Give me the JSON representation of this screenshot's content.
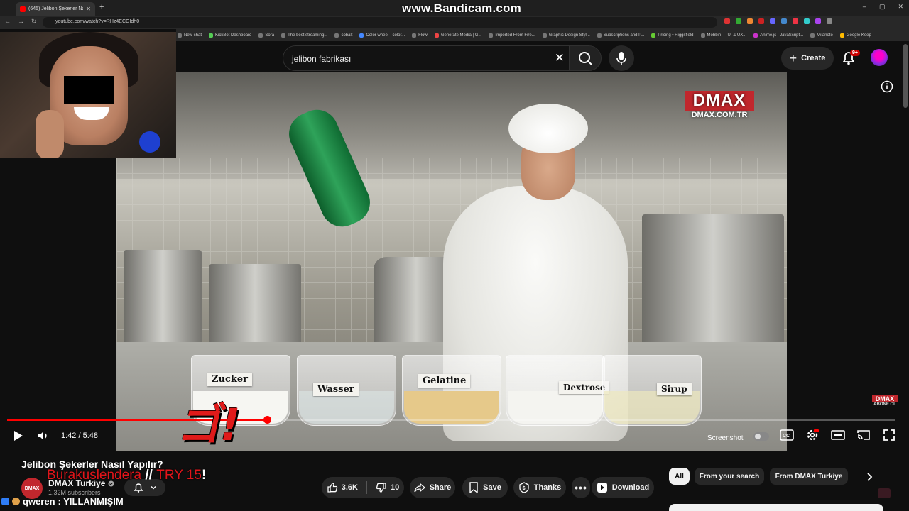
{
  "browser": {
    "tab_title": "(645) Jelibon Şekerler Nasıl Yapı",
    "url": "youtube.com/watch?v=RHz4ECGIdh0",
    "watermark": "www.Bandicam.com",
    "bookmarks": [
      "New chat",
      "KickBot Dashboard",
      "Sora",
      "The best streaming...",
      "cobalt",
      "Color wheel - color...",
      "Flow",
      "Generate Media | G...",
      "Imported From Fire...",
      "Graphic Design Styl...",
      "Subscriptions and P...",
      "Pricing • Higgsfield",
      "Mobbin — UI & UX...",
      "Anime.js | JavaScript...",
      "Milanote",
      "Google Keep"
    ]
  },
  "header": {
    "search_value": "jelibon fabrikası",
    "create_label": "Create",
    "notifications_badge": "9+"
  },
  "video": {
    "bowl_labels": [
      "Zucker",
      "Wasser",
      "Gelatine",
      "Dextrose",
      "Sirup"
    ],
    "watermark_main": "DMAX",
    "watermark_url": "DMAX.COM.TR",
    "corner_logo": "DMAX",
    "corner_logo_sub": "ABONE OL",
    "current_time": "1:42",
    "duration": "5:48",
    "progress_fraction": 0.293,
    "screenshot_label": "Screenshot"
  },
  "overlay": {
    "pow_text": "ゴ!",
    "name": "Burakuslendera",
    "sep": " // ",
    "tag": "TRY 15",
    "bang": "!",
    "chat_user": "qweren",
    "chat_message": " : YILLANMIŞIM"
  },
  "details": {
    "title": "Jelibon Şekerler Nasıl Yapılır?",
    "channel_logo_text": "DMAX",
    "channel_name": "DMAX Turkiye",
    "subscribers": "1.32M subscribers",
    "likes": "3.6K",
    "dislikes": "10",
    "share": "Share",
    "save": "Save",
    "thanks": "Thanks",
    "download": "Download"
  },
  "chips": [
    "All",
    "From your search",
    "From DMAX Turkiye"
  ],
  "colors": {
    "accent": "#ff0000",
    "brand_dmax": "#c1272d",
    "background": "#0f0f0f"
  }
}
